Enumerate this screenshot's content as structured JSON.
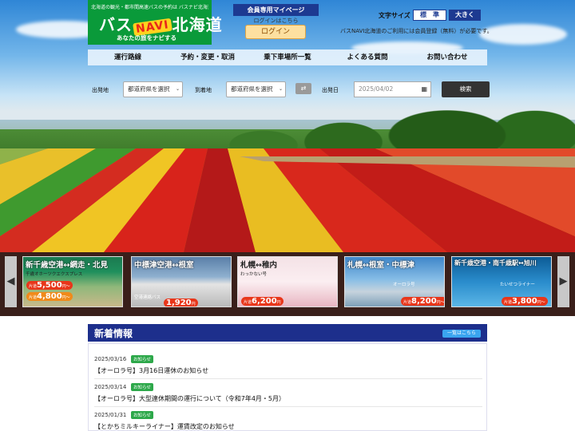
{
  "header": {
    "tagline": "北海道の観光・都市間高速バスの予約は バスナビ北海道",
    "logo_text_a": "バス",
    "logo_text_navi": "NAVI",
    "logo_text_b": "北海道",
    "logo_catch": "あなたの旅をナビする",
    "member_title": "会員専用マイページ",
    "login_hint": "ログインはこちら",
    "login_button": "ログイン",
    "font_size_label": "文字サイズ",
    "font_normal": "標　準",
    "font_large": "大きく",
    "member_note": "バスNAVI北海道のご利用には会員登録（無料）が必要です。"
  },
  "nav": {
    "items": [
      "運行路線",
      "予約・変更・取消",
      "乗下車場所一覧",
      "よくある質問",
      "お問い合わせ"
    ]
  },
  "search": {
    "departure_label": "出発地",
    "departure_select": "都道府県を選択",
    "arrival_label": "到着地",
    "arrival_select": "都道府県を選択",
    "swap_icon": "⇄",
    "date_label": "出発日",
    "date_value": "2025/04/02",
    "search_button": "検索"
  },
  "carousel": {
    "prev": "◀",
    "next": "▶",
    "banners": [
      {
        "title": "新千歳空港↔網走・北見",
        "sub": "千歳オホーツクエクスプレス",
        "price1": "5,500",
        "price2": "4,800",
        "price_prefix": "片道",
        "price_suffix": "円〜"
      },
      {
        "title": "中標津空港↔根室",
        "sub": "空港連絡バス",
        "price1": "1,920",
        "price_prefix": "",
        "price_suffix": "円"
      },
      {
        "title": "札幌↔稚内",
        "sub": "わっかない号",
        "price1": "6,200",
        "price_prefix": "片道",
        "price_suffix": "円"
      },
      {
        "title": "札幌↔根室・中標津",
        "sub": "オーロラ号",
        "price1": "8,200",
        "price_prefix": "片道",
        "price_suffix": "円〜"
      },
      {
        "title": "新千歳空港・南千歳駅↔旭川",
        "sub": "たいせつライナー",
        "price1": "3,800",
        "price_prefix": "片道",
        "price_suffix": "円〜"
      }
    ]
  },
  "news": {
    "title": "新着情報",
    "more": "一覧はこちら",
    "badge": "お知らせ",
    "items": [
      {
        "date": "2025/03/16",
        "text": "【オーロラ号】3月16日運休のお知らせ"
      },
      {
        "date": "2025/03/14",
        "text": "【オーロラ号】大型連休期間の運行について（令和7年4月・5月）"
      },
      {
        "date": "2025/01/31",
        "text": "【とかちミルキーライナー】運賃改定のお知らせ"
      }
    ]
  }
}
